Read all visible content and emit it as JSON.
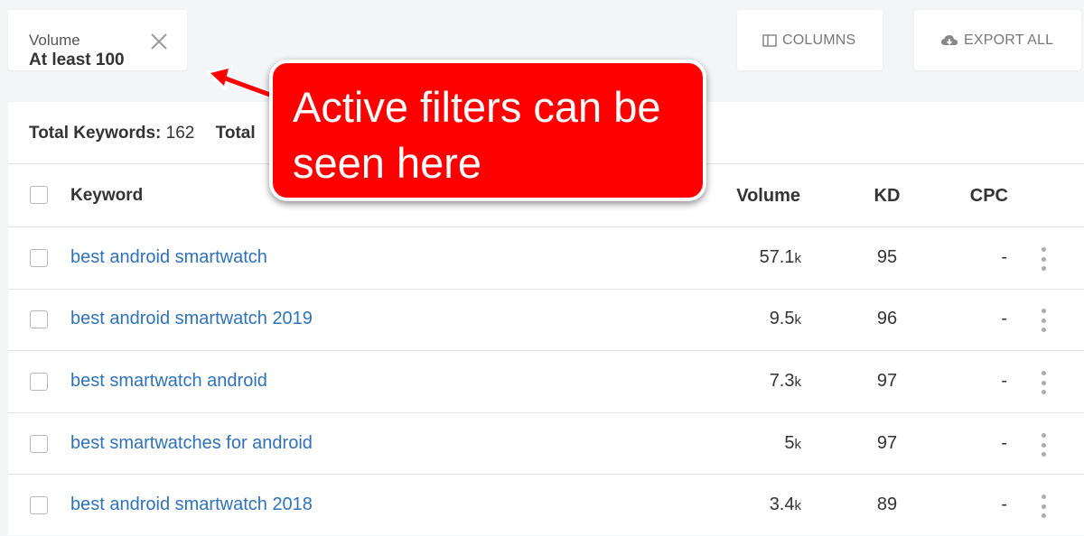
{
  "filter": {
    "label": "Volume",
    "value": "At least 100"
  },
  "toolbar": {
    "columns_label": "COLUMNS",
    "export_label": "EXPORT ALL"
  },
  "summary": {
    "keywords_label": "Total Keywords:",
    "keywords_count": "162",
    "second_label_partial": "Total"
  },
  "table": {
    "headers": {
      "keyword": "Keyword",
      "volume": "Volume",
      "kd": "KD",
      "cpc": "CPC"
    },
    "rows": [
      {
        "keyword": "best android smartwatch",
        "volume": "57.1",
        "unit": "k",
        "kd": "95",
        "cpc": "-"
      },
      {
        "keyword": "best android smartwatch 2019",
        "volume": "9.5",
        "unit": "k",
        "kd": "96",
        "cpc": "-"
      },
      {
        "keyword": "best smartwatch android",
        "volume": "7.3",
        "unit": "k",
        "kd": "97",
        "cpc": "-"
      },
      {
        "keyword": "best smartwatches for android",
        "volume": "5",
        "unit": "k",
        "kd": "97",
        "cpc": "-"
      },
      {
        "keyword": "best android smartwatch 2018",
        "volume": "3.4",
        "unit": "k",
        "kd": "89",
        "cpc": "-"
      }
    ]
  },
  "annotation": {
    "text": "Active filters can be seen here",
    "color": "#ff0000"
  },
  "colors": {
    "link": "#2f72b8",
    "background": "#f4f5f7"
  }
}
